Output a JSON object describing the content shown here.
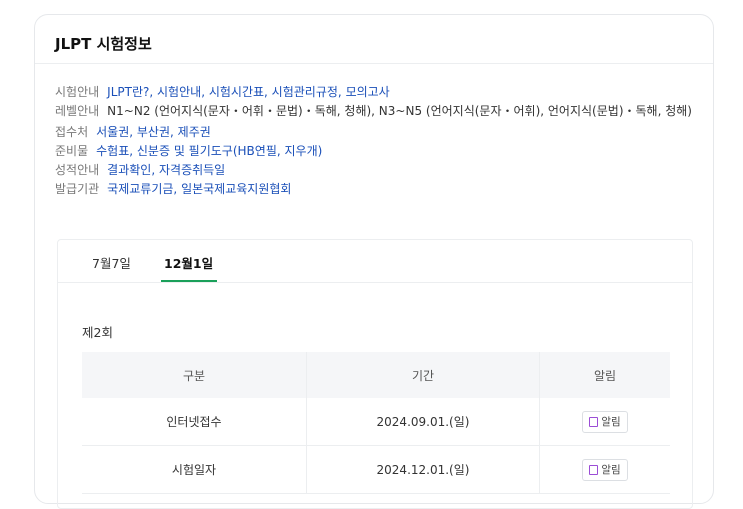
{
  "card": {
    "title": "JLPT 시험정보"
  },
  "info": [
    {
      "label": "시험안내",
      "links": [
        "JLPT란?",
        "시험안내",
        "시험시간표",
        "시험관리규정",
        "모의고사"
      ],
      "sep": ", "
    },
    {
      "label": "레벨안내",
      "text": "N1~N2 (언어지식(문자・어휘・문법)・독해, 청해), N3~N5 (언어지식(문자・어휘), 언어지식(문법)・독해, 청해)"
    },
    {
      "label": "접수처",
      "links": [
        "서울권",
        "부산권",
        "제주권"
      ],
      "sep": ", "
    },
    {
      "label": "준비물",
      "links": [
        "수험표",
        "신분증 및 필기도구(HB연필, 지우개)"
      ],
      "sep": ", "
    },
    {
      "label": "성적안내",
      "links": [
        "결과확인",
        "자격증취득일"
      ],
      "sep": ", "
    },
    {
      "label": "발급기관",
      "links": [
        "국제교류기금",
        "일본국제교육지원협회"
      ],
      "sep": ", "
    }
  ],
  "tabs": [
    {
      "label": "7월7일",
      "active": false
    },
    {
      "label": "12월1일",
      "active": true
    }
  ],
  "round": "제2회",
  "table": {
    "headers": [
      "구분",
      "기간",
      "알림"
    ],
    "rows": [
      {
        "type": "인터넷접수",
        "date": "2024.09.01.(일)",
        "alert": "알림"
      },
      {
        "type": "시험일자",
        "date": "2024.12.01.(일)",
        "alert": "알림"
      }
    ]
  }
}
